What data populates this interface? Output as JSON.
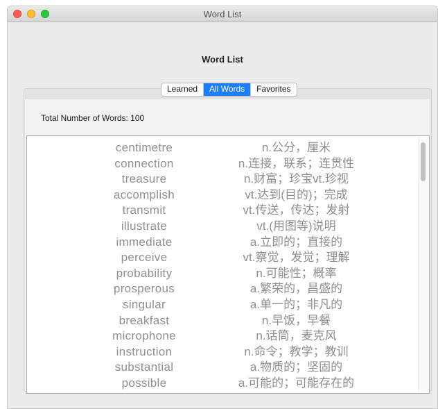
{
  "window": {
    "title": "Word List"
  },
  "heading": "Word List",
  "tabs": [
    {
      "label": "Learned",
      "selected": false
    },
    {
      "label": "All Words",
      "selected": true
    },
    {
      "label": "Favorites",
      "selected": false
    }
  ],
  "total_label": "Total Number of Words: 100",
  "words": [
    {
      "word": "centimetre",
      "meaning": "n.公分，厘米"
    },
    {
      "word": "connection",
      "meaning": "n.连接，联系；连贯性"
    },
    {
      "word": "treasure",
      "meaning": "n.财富；珍宝vt.珍视"
    },
    {
      "word": "accomplish",
      "meaning": "vt.达到(目的)；完成"
    },
    {
      "word": "transmit",
      "meaning": "vt.传送，传达；发射"
    },
    {
      "word": "illustrate",
      "meaning": "vt.(用图等)说明"
    },
    {
      "word": "immediate",
      "meaning": "a.立即的；直接的"
    },
    {
      "word": "perceive",
      "meaning": "vt.察觉，发觉；理解"
    },
    {
      "word": "probability",
      "meaning": "n.可能性；概率"
    },
    {
      "word": "prosperous",
      "meaning": "a.繁荣的，昌盛的"
    },
    {
      "word": "singular",
      "meaning": "a.单一的；非凡的"
    },
    {
      "word": "breakfast",
      "meaning": "n.早饭，早餐"
    },
    {
      "word": "microphone",
      "meaning": "n.话筒，麦克风"
    },
    {
      "word": "instruction",
      "meaning": "n.命令；教学；教训"
    },
    {
      "word": "substantial",
      "meaning": "a.物质的；坚固的"
    },
    {
      "word": "possible",
      "meaning": "a.可能的；可能存在的"
    }
  ],
  "colors": {
    "accent": "#1c7ef6",
    "close": "#fe5f57",
    "minimize": "#febc2e",
    "maximize": "#28c840"
  }
}
